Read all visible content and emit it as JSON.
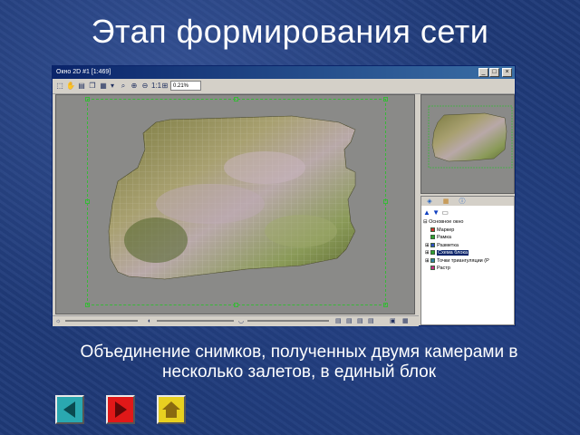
{
  "slide": {
    "title": "Этап формирования сети",
    "caption_line1": "Объединение снимков, полученных двумя камерами в",
    "caption_line2": "несколько залетов, в единый блок"
  },
  "window": {
    "title": "Окно 2D #1 [1:469]",
    "buttons": [
      "minimize-icon",
      "maximize-icon",
      "close-icon"
    ],
    "zoom_value": "0.21%"
  },
  "toolbar": {
    "tools": [
      "pointer-icon",
      "hand-icon",
      "search-icon",
      "zoom-in-icon",
      "zoom-out-icon",
      "fit-icon",
      "scale-1-1-icon"
    ]
  },
  "layer_panel": {
    "tabs": [
      "layers-tab-icon",
      "grid-tab-icon",
      "info-tab-icon"
    ],
    "tree": [
      {
        "label": "Основное окно",
        "level": 0,
        "color": "#ffffff",
        "selected": false
      },
      {
        "label": "Маркер",
        "level": 1,
        "color": "#d03030",
        "selected": false
      },
      {
        "label": "Рамка",
        "level": 1,
        "color": "#30a030",
        "selected": false
      },
      {
        "label": "Разметка",
        "level": 1,
        "color": "#3050c0",
        "selected": false
      },
      {
        "label": "Схема блока",
        "level": 1,
        "color": "#30a030",
        "selected": true
      },
      {
        "label": "Точки триангуляции (Р",
        "level": 1,
        "color": "#3080a0",
        "selected": false
      },
      {
        "label": "Растр",
        "level": 1,
        "color": "#c03080",
        "selected": false
      }
    ]
  },
  "colors": {
    "background": "#1f3a78",
    "selection": "#38b838",
    "canvas": "#8a8a88",
    "nav_back": "#2aa8b0",
    "nav_forward": "#e01818",
    "nav_home": "#e8d020"
  },
  "navigation": [
    "back-button",
    "forward-button",
    "home-button"
  ]
}
